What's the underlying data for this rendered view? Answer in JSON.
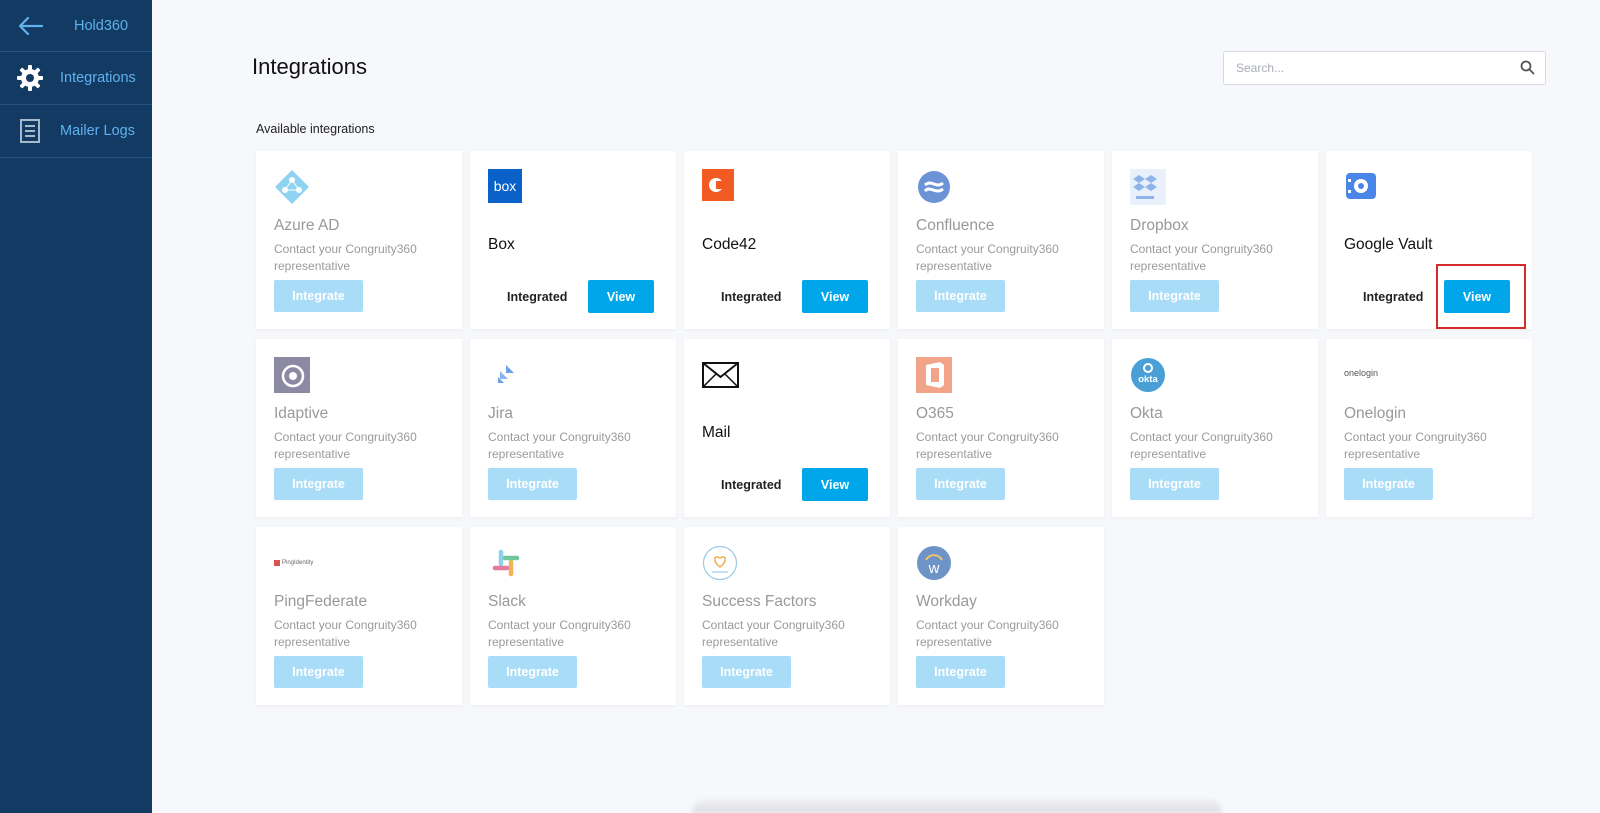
{
  "sidebar": {
    "app_title": "Hold360",
    "items": [
      {
        "label": "Integrations",
        "icon": "gear-icon"
      },
      {
        "label": "Mailer Logs",
        "icon": "document-icon"
      }
    ]
  },
  "header": {
    "title": "Integrations",
    "search_placeholder": "Search..."
  },
  "section_label": "Available integrations",
  "integrations": [
    {
      "name": "Azure AD",
      "status": "available",
      "description": "Contact your Congruity360 representative",
      "button": "Integrate",
      "icon": "azure-ad-icon"
    },
    {
      "name": "Box",
      "status": "integrated",
      "status_label": "Integrated",
      "button": "View",
      "icon": "box-logo-icon"
    },
    {
      "name": "Code42",
      "status": "integrated",
      "status_label": "Integrated",
      "button": "View",
      "icon": "code42-logo-icon"
    },
    {
      "name": "Confluence",
      "status": "available",
      "description": "Contact your Congruity360 representative",
      "button": "Integrate",
      "icon": "confluence-logo-icon"
    },
    {
      "name": "Dropbox",
      "status": "available",
      "description": "Contact your Congruity360 representative",
      "button": "Integrate",
      "icon": "dropbox-logo-icon"
    },
    {
      "name": "Google Vault",
      "status": "integrated",
      "status_label": "Integrated",
      "button": "View",
      "icon": "google-vault-logo-icon"
    },
    {
      "name": "Idaptive",
      "status": "available",
      "description": "Contact your Congruity360 representative",
      "button": "Integrate",
      "icon": "idaptive-logo-icon"
    },
    {
      "name": "Jira",
      "status": "available",
      "description": "Contact your Congruity360 representative",
      "button": "Integrate",
      "icon": "jira-logo-icon"
    },
    {
      "name": "Mail",
      "status": "integrated",
      "status_label": "Integrated",
      "button": "View",
      "icon": "mail-envelope-icon"
    },
    {
      "name": "O365",
      "status": "available",
      "description": "Contact your Congruity360 representative",
      "button": "Integrate",
      "icon": "office365-logo-icon"
    },
    {
      "name": "Okta",
      "status": "available",
      "description": "Contact your Congruity360 representative",
      "button": "Integrate",
      "icon": "okta-logo-icon",
      "logo_text": "okta"
    },
    {
      "name": "Onelogin",
      "status": "available",
      "description": "Contact your Congruity360 representative",
      "button": "Integrate",
      "icon": "onelogin-logo-icon",
      "logo_text": "onelogin"
    },
    {
      "name": "PingFederate",
      "status": "available",
      "description": "Contact your Congruity360 representative",
      "button": "Integrate",
      "icon": "pingidentity-logo-icon",
      "logo_text": "PingIdentity"
    },
    {
      "name": "Slack",
      "status": "available",
      "description": "Contact your Congruity360 representative",
      "button": "Integrate",
      "icon": "slack-logo-icon"
    },
    {
      "name": "Success Factors",
      "status": "available",
      "description": "Contact your Congruity360 representative",
      "button": "Integrate",
      "icon": "successfactors-logo-icon"
    },
    {
      "name": "Workday",
      "status": "available",
      "description": "Contact your Congruity360 representative",
      "button": "Integrate",
      "icon": "workday-logo-icon"
    }
  ],
  "colors": {
    "sidebar_bg": "#123a63",
    "sidebar_text": "#5fb2ec",
    "primary_button": "#00a6ea",
    "disabled_button": "#a9dcf6",
    "highlight": "#d62b2b"
  }
}
